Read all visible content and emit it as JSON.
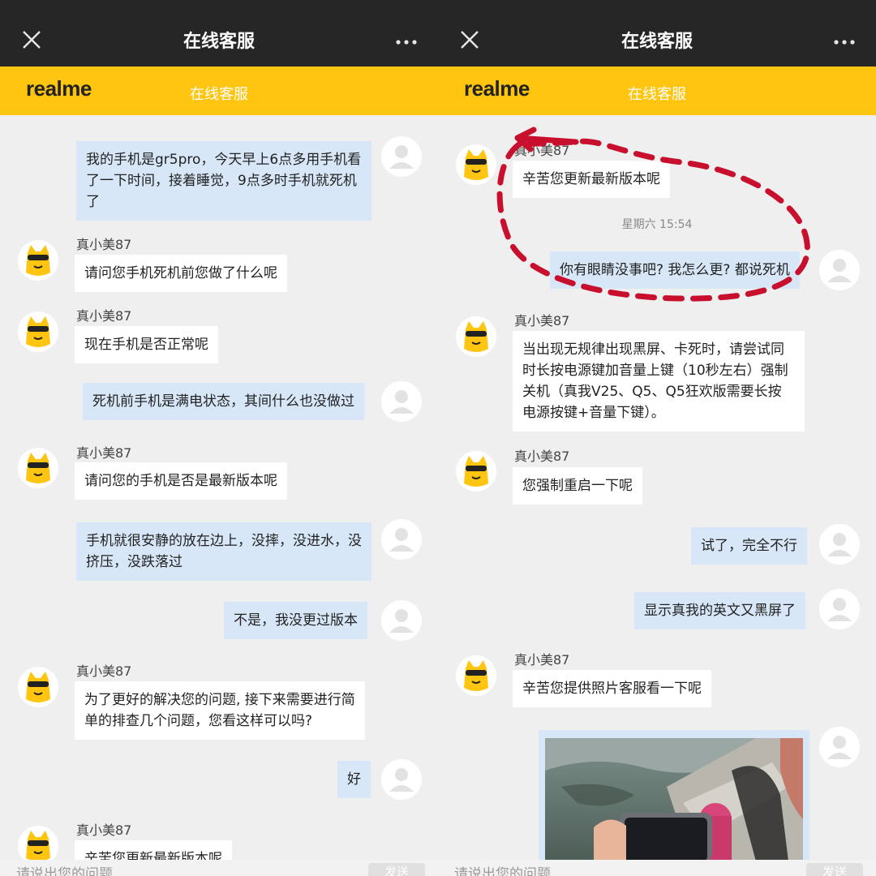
{
  "header": {
    "title": "在线客服"
  },
  "brand": {
    "logo_text": "realme",
    "subtitle": "在线客服"
  },
  "input": {
    "placeholder": "请说出您的问题",
    "send_label": "发送"
  },
  "left_chat": {
    "messages": [
      {
        "sender": "user",
        "text": "我的手机是gr5pro，今天早上6点多用手机看了一下时间，接着睡觉，9点多时手机就死机了"
      },
      {
        "sender": "agent",
        "name": "真小美87",
        "text": "请问您手机死机前您做了什么呢"
      },
      {
        "sender": "agent",
        "name": "真小美87",
        "text": "现在手机是否正常呢"
      },
      {
        "sender": "user",
        "text": "死机前手机是满电状态，其间什么也没做过"
      },
      {
        "sender": "agent",
        "name": "真小美87",
        "text": "请问您的手机是否是最新版本呢"
      },
      {
        "sender": "user",
        "text": "手机就很安静的放在边上，没摔，没进水，没挤压，没跌落过"
      },
      {
        "sender": "user",
        "text": "不是，我没更过版本"
      },
      {
        "sender": "agent",
        "name": "真小美87",
        "text": "为了更好的解决您的问题, 接下来需要进行简单的排查几个问题，您看这样可以吗?"
      },
      {
        "sender": "user",
        "text": "好"
      },
      {
        "sender": "agent",
        "name": "真小美87",
        "text": "辛苦您更新最新版本呢"
      }
    ]
  },
  "right_chat": {
    "messages": [
      {
        "sender": "agent",
        "name": "真小美87",
        "text": "辛苦您更新最新版本呢"
      },
      {
        "sender": "system",
        "text": "星期六 15:54"
      },
      {
        "sender": "user",
        "text": "你有眼睛没事吧? 我怎么更? 都说死机"
      },
      {
        "sender": "agent",
        "name": "真小美87",
        "text": "当出现无规律出现黑屏、卡死时，请尝试同时长按电源键加音量上键（10秒左右）强制关机（真我V25、Q5、Q5狂欢版需要长按电源按键+音量下键）。"
      },
      {
        "sender": "agent",
        "name": "真小美87",
        "text": "您强制重启一下呢"
      },
      {
        "sender": "user",
        "text": "试了，完全不行"
      },
      {
        "sender": "user",
        "text": "显示真我的英文又黑屏了"
      },
      {
        "sender": "agent",
        "name": "真小美87",
        "text": "辛苦您提供照片客服看一下呢"
      },
      {
        "sender": "user",
        "type": "photo"
      }
    ]
  },
  "colors": {
    "brand_yellow": "#ffc510",
    "title_bar": "#262626",
    "user_bubble": "#d7e7f7",
    "annotation_red": "#c8102e"
  }
}
